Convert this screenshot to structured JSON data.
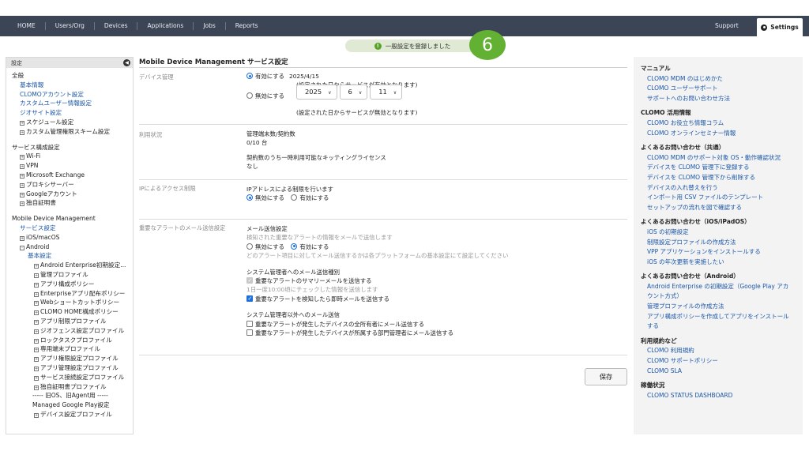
{
  "nav": {
    "items": [
      "HOME",
      "Users/Org",
      "Devices",
      "Applications",
      "Jobs",
      "Reports"
    ],
    "support": "Support",
    "settings": "Settings"
  },
  "toast": {
    "message": "一般設定を登録しました",
    "step": "6"
  },
  "sidebar": {
    "header": "設定",
    "general": "全般",
    "general_items": [
      "基本情報",
      "CLOMOアカウント設定",
      "カスタムユーザー情報設定",
      "ジオサイト設定"
    ],
    "general_sub": [
      "スケジュール設定",
      "カスタム管理権限スキーム設定"
    ],
    "service": "サービス構成設定",
    "service_items": [
      "Wi-Fi",
      "VPN",
      "Microsoft Exchange",
      "プロキシサーバー",
      "Googleアカウント",
      "独自証明書"
    ],
    "mdm": "Mobile Device Management",
    "mdm_service": "サービス設定",
    "ios": "iOS/macOS",
    "android": "Android",
    "basic": "基本設定",
    "android_items": [
      "Android Enterprise初期設定...",
      "管理プロファイル",
      "アプリ構成ポリシー",
      "Enterpriseアプリ配布ポリシー",
      "Webショートカットポリシー",
      "CLOMO HOME構成ポリシー",
      "アプリ制限プロファイル",
      "ジオフェンス設定プロファイル",
      "ロックタスクプロファイル",
      "専用端末プロファイル",
      "アプリ権限設定プロファイル",
      "アプリ管理設定プロファイル",
      "サービス接続設定プロファイル",
      "独自証明書プロファイル"
    ],
    "legacy": "----- 旧OS、旧Agent用 -----",
    "managed_gp": "Managed Google Play設定",
    "device_profile": "デバイス設定プロファイル"
  },
  "main": {
    "title": "Mobile Device Management サービス設定",
    "device_mgmt": {
      "label": "デバイス管理",
      "enable": "有効にする",
      "enable_date": "2025/4/15",
      "enable_note": "(設定された日からサービスが有効となります)",
      "disable": "無効にする",
      "year": "2025",
      "month": "6",
      "day": "11",
      "disable_note": "(設定された日からサービスが無効となります)"
    },
    "usage": {
      "label": "利用状況",
      "count_title": "管理端末数/契約数",
      "count_value": "0/10 台",
      "kit_title": "契約数のうち一時利用可能なキッティングライセンス",
      "kit_value": "なし"
    },
    "ip": {
      "label": "IPによるアクセス制限",
      "title": "IPアドレスによる制限を行います",
      "disable": "無効にする",
      "enable": "有効にする"
    },
    "alert": {
      "label": "重要なアラートのメール送信設定",
      "mail_title": "メール送信設定",
      "mail_desc": "検知された重要なアラートの情報をメールで送信します",
      "disable": "無効にする",
      "enable": "有効にする",
      "mail_note": "どのアラート項目に対してメール送信するかは各プラットフォームの基本設定にて設定してください",
      "admin_title": "システム管理者へのメール送信種別",
      "summary": "重要なアラートのサマリーメールを送信する",
      "summary_note": "1日一度10:00頃にチェックした情報を送信します",
      "instant": "重要なアラートを検知したら即時メールを送信する",
      "other_title": "システム管理者以外へのメール送信",
      "owners": "重要なアラートが発生したデバイスの全所有者にメール送信する",
      "dept": "重要なアラートが発生したデバイスが所属する部門管理者にメール送信する"
    },
    "save": "保存"
  },
  "right": {
    "manual_h": "マニュアル",
    "manual": [
      "CLOMO MDM のはじめかた",
      "CLOMO ユーザーサポート",
      "サポートへのお問い合わせ方法"
    ],
    "use_h": "CLOMO 活用情報",
    "use": [
      "CLOMO お役立ち情報コラム",
      "CLOMO オンラインセミナー情報"
    ],
    "faq_common_h": "よくあるお問い合わせ（共通）",
    "faq_common": [
      "CLOMO MDM のサポート対象 OS・動作確認状況",
      "デバイスを CLOMO 管理下に登録する",
      "デバイスを CLOMO 管理下から削除する",
      "デバイスの入れ替えを行う",
      "インポート用 CSV ファイルのテンプレート",
      "セットアップの流れを図で確認する"
    ],
    "faq_ios_h": "よくあるお問い合わせ（iOS/iPadOS）",
    "faq_ios": [
      "iOS の初期設定",
      "制限設定プロファイルの作成方法",
      "VPP アプリケーションをインストールする",
      "iOS の年次更新を実施したい"
    ],
    "faq_android_h": "よくあるお問い合わせ（Android）",
    "faq_android": [
      "Android Enterprise の初期設定（Google Play アカウント方式）",
      "管理プロファイルの作成方法",
      "アプリ構成ポリシーを作成してアプリをインストールする"
    ],
    "terms_h": "利用規約など",
    "terms": [
      "CLOMO 利用規約",
      "CLOMO サポートポリシー",
      "CLOMO SLA"
    ],
    "status_h": "稼働状況",
    "status": [
      "CLOMO STATUS DASHBOARD"
    ]
  }
}
